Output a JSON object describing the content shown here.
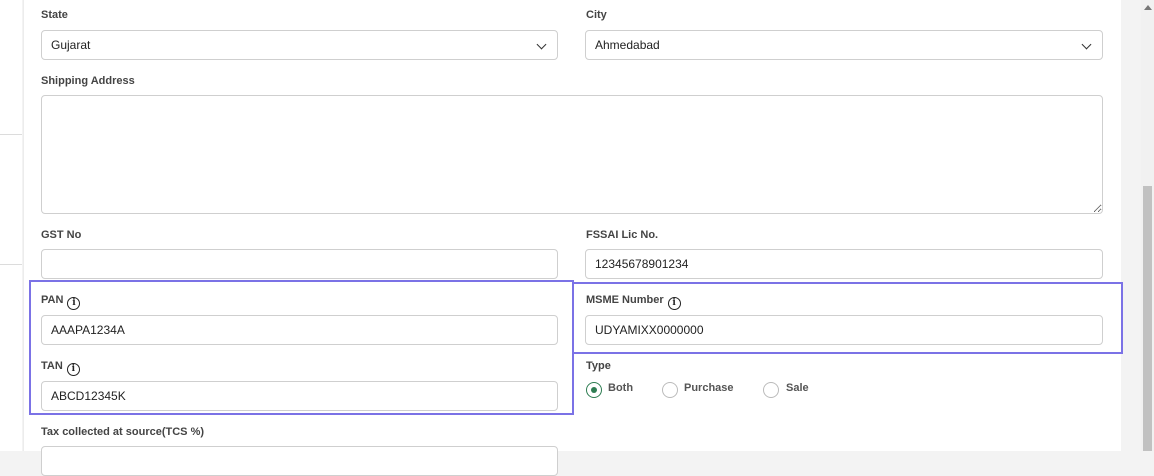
{
  "form": {
    "state": {
      "label": "State",
      "value": "Gujarat"
    },
    "city": {
      "label": "City",
      "value": "Ahmedabad"
    },
    "shipping_address": {
      "label": "Shipping Address",
      "value": ""
    },
    "gst_no": {
      "label": "GST No",
      "value": ""
    },
    "fssai": {
      "label": "FSSAI Lic No.",
      "value": "12345678901234"
    },
    "pan": {
      "label": "PAN",
      "value": "AAAPA1234A"
    },
    "msme": {
      "label": "MSME Number",
      "value": "UDYAMIXX0000000"
    },
    "tan": {
      "label": "TAN",
      "value": "ABCD12345K"
    },
    "type": {
      "label": "Type",
      "options": [
        "Both",
        "Purchase",
        "Sale"
      ],
      "selected": "Both"
    },
    "tcs": {
      "label": "Tax collected at source(TCS %)"
    }
  },
  "icons": {
    "info": "i"
  },
  "colors": {
    "highlight": "#7b72e6",
    "radio_selected": "#2e7d52"
  }
}
